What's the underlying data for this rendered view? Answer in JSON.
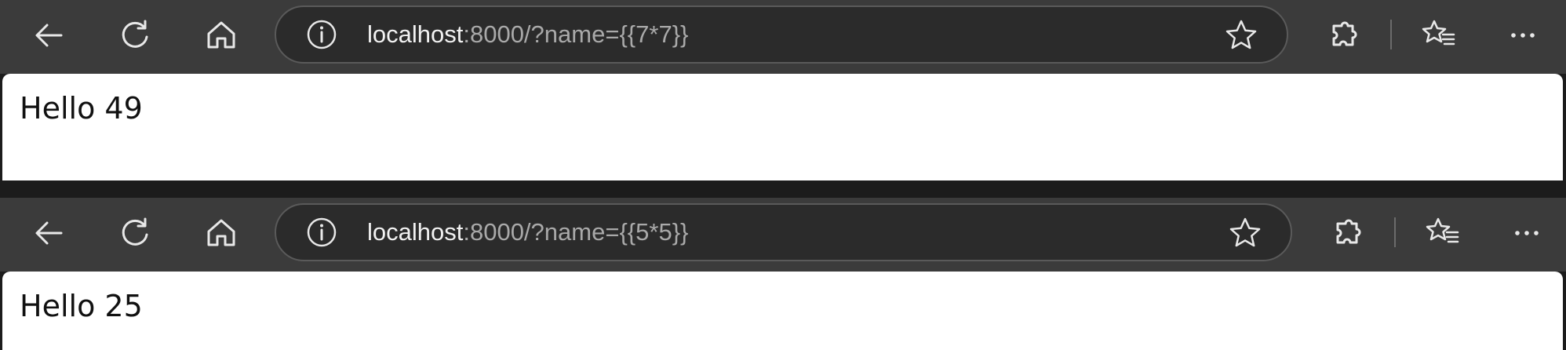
{
  "windows": [
    {
      "address_bar": {
        "host": "localhost",
        "rest": ":8000/?name={{7*7}}"
      },
      "page": {
        "text": "Hello 49"
      }
    },
    {
      "address_bar": {
        "host": "localhost",
        "rest": ":8000/?name={{5*5}}"
      },
      "page": {
        "text": "Hello 25"
      }
    }
  ],
  "toolbar_icons": [
    "back-icon",
    "refresh-icon",
    "home-icon",
    "info-icon",
    "favorite-star-icon",
    "extensions-icon",
    "favorites-icon",
    "more-icon"
  ],
  "colors": {
    "toolbar_bg": "#3b3b3b",
    "address_bg": "#2b2b2b",
    "host_text": "#f2f2f2",
    "path_text": "#a9a9a9",
    "icon": "#e8e8e8",
    "page_bg": "#ffffff",
    "separator": "#1c1c1c"
  }
}
